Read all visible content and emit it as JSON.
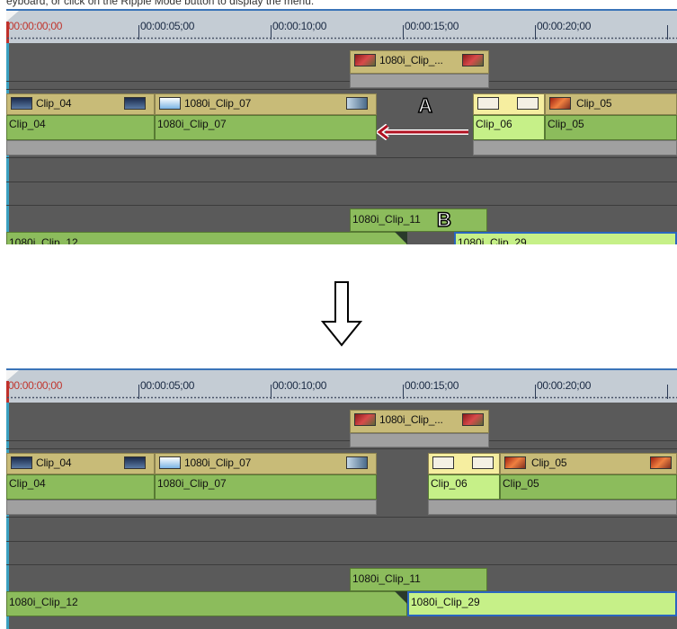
{
  "header_text": "eyboard, or click on the Ripple Mode button to display the menu.",
  "ruler": {
    "timecodes": [
      "00:00:00;00",
      "00:00:05;00",
      "00:00:10;00",
      "00:00:15;00",
      "00:00:20;00"
    ]
  },
  "clips": {
    "clip_top": "1080i_Clip_...",
    "clip_04": "Clip_04",
    "clip_07": "1080i_Clip_07",
    "clip_06": "Clip_06",
    "clip_05": "Clip_05",
    "clip_11": "1080i_Clip_11",
    "clip_12": "1080i_Clip_12",
    "clip_29": "1080i_Clip_29"
  },
  "markers": {
    "a": "A",
    "b": "B"
  },
  "colors": {
    "arrow": "#b01020",
    "selection_outline": "#2a66c0",
    "video_clip": "#c8bb78",
    "audio_clip": "#8cbc5c",
    "selected_audio_clip": "#c6f088"
  },
  "icons": {
    "transition_arrow": "down-arrow-outline-icon"
  }
}
